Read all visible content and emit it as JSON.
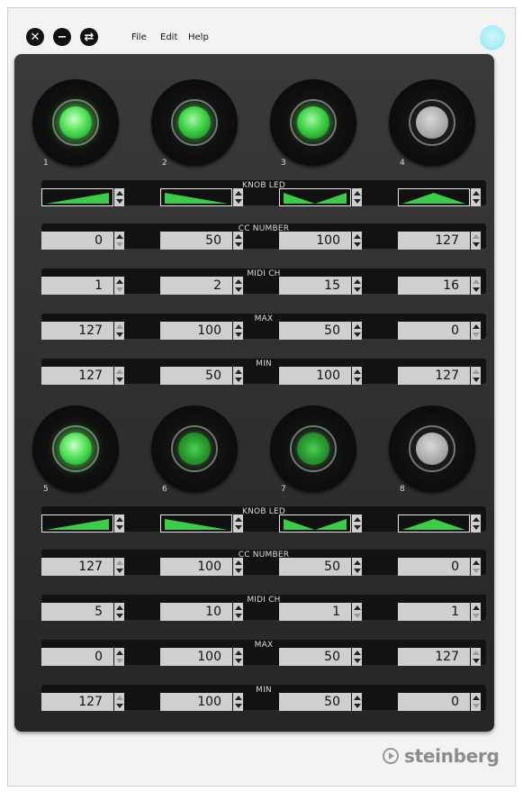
{
  "menu": [
    "File",
    "Edit",
    "Help"
  ],
  "window_buttons": {
    "close": "close-icon",
    "minimize": "minimize-icon",
    "swap": "swap-icon"
  },
  "brand": "steinberg",
  "colors": {
    "panel": "#2e2e2e",
    "led_on": "#4be04b",
    "led_off": "#b0b0b0",
    "value_bg": "#cfcfcf",
    "status_led": "#a8eef5"
  },
  "banks": [
    {
      "knobs": [
        {
          "number": "1",
          "state": "on"
        },
        {
          "number": "2",
          "state": "mid"
        },
        {
          "number": "3",
          "state": "mid"
        },
        {
          "number": "4",
          "state": "off"
        }
      ],
      "sections": [
        {
          "label": "KNOB LED",
          "type": "led",
          "values": [
            "ramp-up",
            "ramp-down",
            "v-shape",
            "peak"
          ]
        },
        {
          "label": "CC NUMBER",
          "type": "num",
          "values": [
            "0",
            "50",
            "100",
            "127"
          ]
        },
        {
          "label": "MIDI CH",
          "type": "num",
          "values": [
            "1",
            "2",
            "15",
            "16"
          ]
        },
        {
          "label": "MAX",
          "type": "num",
          "values": [
            "127",
            "100",
            "50",
            "0"
          ]
        },
        {
          "label": "MIN",
          "type": "num",
          "values": [
            "127",
            "50",
            "100",
            "127"
          ]
        }
      ]
    },
    {
      "knobs": [
        {
          "number": "5",
          "state": "on"
        },
        {
          "number": "6",
          "state": "dim"
        },
        {
          "number": "7",
          "state": "dim"
        },
        {
          "number": "8",
          "state": "off"
        }
      ],
      "sections": [
        {
          "label": "KNOB LED",
          "type": "led",
          "values": [
            "ramp-up",
            "ramp-down",
            "v-shape",
            "peak"
          ]
        },
        {
          "label": "CC NUMBER",
          "type": "num",
          "values": [
            "127",
            "100",
            "50",
            "0"
          ]
        },
        {
          "label": "MIDI CH",
          "type": "num",
          "values": [
            "5",
            "10",
            "1",
            "1"
          ]
        },
        {
          "label": "MAX",
          "type": "num",
          "values": [
            "0",
            "100",
            "50",
            "127"
          ]
        },
        {
          "label": "MIN",
          "type": "num",
          "values": [
            "127",
            "100",
            "50",
            "0"
          ]
        }
      ]
    }
  ]
}
